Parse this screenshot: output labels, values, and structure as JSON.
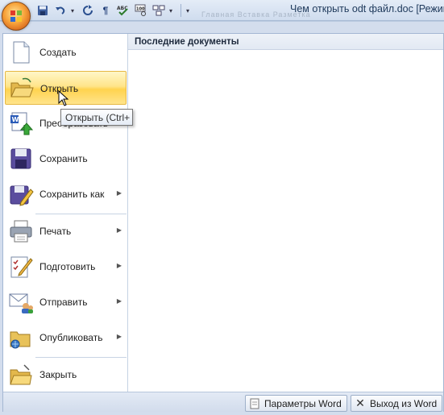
{
  "window": {
    "title": "Чем открыть odt файл.doc [Режим",
    "ghost_tabs": "Главная    Вставка    Разметка"
  },
  "quick_access": {
    "icons": [
      "save-icon",
      "undo-icon",
      "redo-icon",
      "paragraph-icon",
      "spelling-icon",
      "zoom-100-icon",
      "view-icon",
      "customize-icon"
    ]
  },
  "menu": {
    "items": [
      {
        "label": "Создать",
        "icon": "new-document-icon",
        "has_submenu": false
      },
      {
        "label": "Открыть",
        "icon": "open-folder-icon",
        "has_submenu": false,
        "highlighted": true
      },
      {
        "label": "Преобразовать",
        "icon": "convert-icon",
        "has_submenu": false
      },
      {
        "label": "Сохранить",
        "icon": "save-disk-icon",
        "has_submenu": false
      },
      {
        "label": "Сохранить как",
        "icon": "save-as-icon",
        "has_submenu": true
      },
      {
        "label": "Печать",
        "icon": "printer-icon",
        "has_submenu": true
      },
      {
        "label": "Подготовить",
        "icon": "prepare-icon",
        "has_submenu": true
      },
      {
        "label": "Отправить",
        "icon": "send-icon",
        "has_submenu": true
      },
      {
        "label": "Опубликовать",
        "icon": "publish-icon",
        "has_submenu": true
      },
      {
        "label": "Закрыть",
        "icon": "close-folder-icon",
        "has_submenu": false
      }
    ],
    "recent_header": "Последние документы",
    "options_button": "Параметры Word",
    "exit_button": "Выход из Word"
  },
  "tooltip": {
    "text": "Открыть (Ctrl+"
  },
  "colors": {
    "highlight": "#ffd34f",
    "office_orange": "#f7a33a",
    "panel_blue": "#d3dded"
  }
}
